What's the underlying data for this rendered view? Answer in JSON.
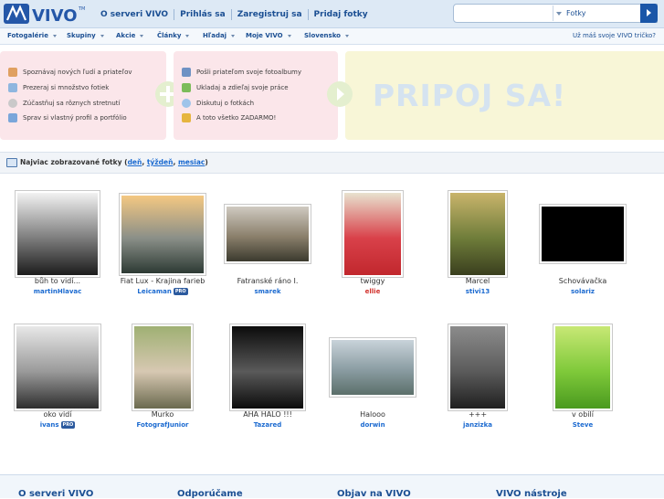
{
  "logo": {
    "text": "VIVO",
    "tm": "TM"
  },
  "topnav": [
    "O serveri VIVO",
    "Prihlás sa",
    "Zaregistruj sa",
    "Pridaj fotky"
  ],
  "search": {
    "value": "",
    "placeholder": "",
    "category": "Fotky"
  },
  "subnav": {
    "items": [
      "Fotogalérie",
      "Skupiny",
      "Akcie",
      "Články",
      "Hľadaj",
      "Moje VIVO",
      "Slovensko"
    ],
    "ask": "Už máš svoje VIVO tričko?"
  },
  "promo": {
    "left": [
      "Spoznávaj nových ľudí a priateľov",
      "Prezeraj si množstvo fotiek",
      "Zúčastňuj sa rôznych stretnutí",
      "Sprav si vlastný profil a portfólio"
    ],
    "right": [
      "Pošli priateľom svoje fotoalbumy",
      "Ukladaj a zdieľaj svoje práce",
      "Diskutuj o fotkách",
      "A toto všetko ZADARMO!"
    ],
    "join": "PRIPOJ SA!"
  },
  "section": {
    "title": "Najviac zobrazované fotky",
    "open": " (",
    "day": "deň",
    "week": "týždeň",
    "month": "mesiac",
    "sep": ", ",
    "close": ")"
  },
  "pro_label": "PRO",
  "photos": [
    {
      "title": "bůh to vidí...",
      "user": "martinHlavac",
      "pro": false,
      "colors": [
        "#f2f2f2",
        "#7d7d7d",
        "#1c1c1c"
      ]
    },
    {
      "title": "Fiat Lux - Krajina farieb",
      "user": "Leicaman",
      "pro": true,
      "colors": [
        "#f4c882",
        "#8a8f88",
        "#2d3a34"
      ]
    },
    {
      "title": "Fatranské ráno I.",
      "user": "smarek",
      "pro": false,
      "colors": [
        "#cfcac1",
        "#8a7f6b",
        "#3b3a2e"
      ]
    },
    {
      "title": "twiggy",
      "user": "ellie",
      "pro": false,
      "red": true,
      "colors": [
        "#e8e2cf",
        "#d9414a",
        "#c1272d"
      ]
    },
    {
      "title": "Marcel",
      "user": "stivi13",
      "pro": false,
      "colors": [
        "#c9b46b",
        "#6f7d3a",
        "#3a3f1e"
      ]
    },
    {
      "title": "Schovávačka",
      "user": "solariz",
      "pro": false,
      "colors": [
        "#000000",
        "#000000",
        "#000000"
      ]
    },
    {
      "title": "oko vidí",
      "user": "ivans",
      "pro": true,
      "colors": [
        "#e8e8e8",
        "#9a9a9a",
        "#2e2e2e"
      ]
    },
    {
      "title": "Murko",
      "user": "FotografJunior",
      "pro": false,
      "colors": [
        "#9fb073",
        "#d7c8b2",
        "#6b6a4f"
      ]
    },
    {
      "title": "AHA HALO !!!",
      "user": "Tazared",
      "pro": false,
      "colors": [
        "#0b0b0b",
        "#5a5a5a",
        "#0b0b0b"
      ]
    },
    {
      "title": "Halooo",
      "user": "dorwin",
      "pro": false,
      "colors": [
        "#c9d3da",
        "#8a9ca2",
        "#5b6f6a"
      ]
    },
    {
      "title": "+++",
      "user": "janzizka",
      "pro": false,
      "colors": [
        "#8c8c8c",
        "#5b5b5b",
        "#202020"
      ]
    },
    {
      "title": "v obilí",
      "user": "Steve",
      "pro": false,
      "colors": [
        "#c8e875",
        "#7fc93a",
        "#4a9a1f"
      ]
    }
  ],
  "footer": [
    "O serveri VIVO",
    "Odporúčame",
    "Objav na VIVO",
    "VIVO nástroje"
  ]
}
